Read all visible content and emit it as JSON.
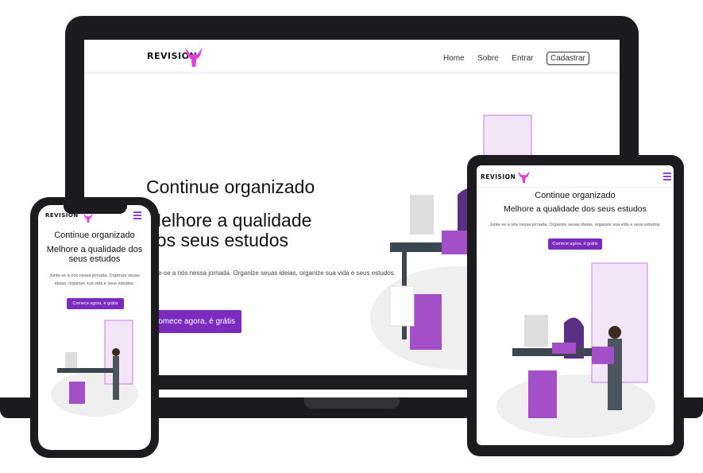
{
  "brand": "REVISION",
  "nav": {
    "home": "Home",
    "about": "Sobre",
    "login": "Entrar",
    "signup": "Cadastrar"
  },
  "hero": {
    "title": "Continue organizado",
    "subtitle": "Melhore a qualidade dos seus estudos",
    "description": "Junte-se a nós nessa jornada. Organize seuas ideias, organize sua vida e seus estudos.",
    "cta": "Comece agora, é grátis"
  },
  "colors": {
    "accent": "#7b2cbf",
    "logo": "#e040d8",
    "device": "#1c1c1e"
  }
}
